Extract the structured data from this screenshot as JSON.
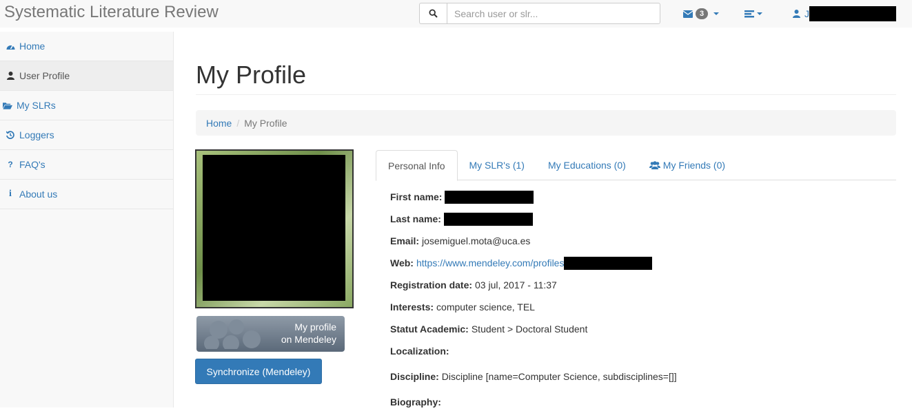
{
  "app": {
    "title": "Systematic Literature Review"
  },
  "search": {
    "placeholder": "Search user or slr..."
  },
  "header": {
    "messages_count": "3",
    "user_initial": "J"
  },
  "sidebar": {
    "items": [
      {
        "label": "Home",
        "icon": "dashboard-icon"
      },
      {
        "label": "User Profile",
        "icon": "user-icon"
      },
      {
        "label": "My SLRs",
        "icon": "folder-open-icon"
      },
      {
        "label": "Loggers",
        "icon": "history-icon"
      },
      {
        "label": "FAQ's",
        "icon": "question-icon"
      },
      {
        "label": "About us",
        "icon": "info-icon"
      }
    ]
  },
  "page": {
    "title": "My Profile"
  },
  "breadcrumb": {
    "home": "Home",
    "current": "My Profile"
  },
  "profile": {
    "mendeley_line1": "My profile",
    "mendeley_line2": "on Mendeley",
    "sync_label": "Synchronize (Mendeley)"
  },
  "tabs": [
    {
      "label": "Personal Info"
    },
    {
      "label": "My SLR's (1)"
    },
    {
      "label": "My Educations (0)"
    },
    {
      "label": "My Friends (0)"
    }
  ],
  "info": {
    "first_name_label": "First name:",
    "last_name_label": "Last name:",
    "email_label": "Email:",
    "email_value": "josemiguel.mota@uca.es",
    "web_label": "Web:",
    "web_value": "https://www.mendeley.com/profiles",
    "registration_label": "Registration date:",
    "registration_value": "03 jul, 2017 - 11:37",
    "interests_label": "Interests:",
    "interests_value": "computer science, TEL",
    "statut_label": "Statut Academic:",
    "statut_value": "Student > Doctoral Student",
    "localization_label": "Localization:",
    "discipline_label": "Discipline:",
    "discipline_value": "Discipline [name=Computer Science, subdisciplines=[]]",
    "biography_label": "Biography:"
  },
  "colors": {
    "link": "#337ab7",
    "primary_button": "#337ab7",
    "sidebar_bg": "#f8f8f8"
  }
}
